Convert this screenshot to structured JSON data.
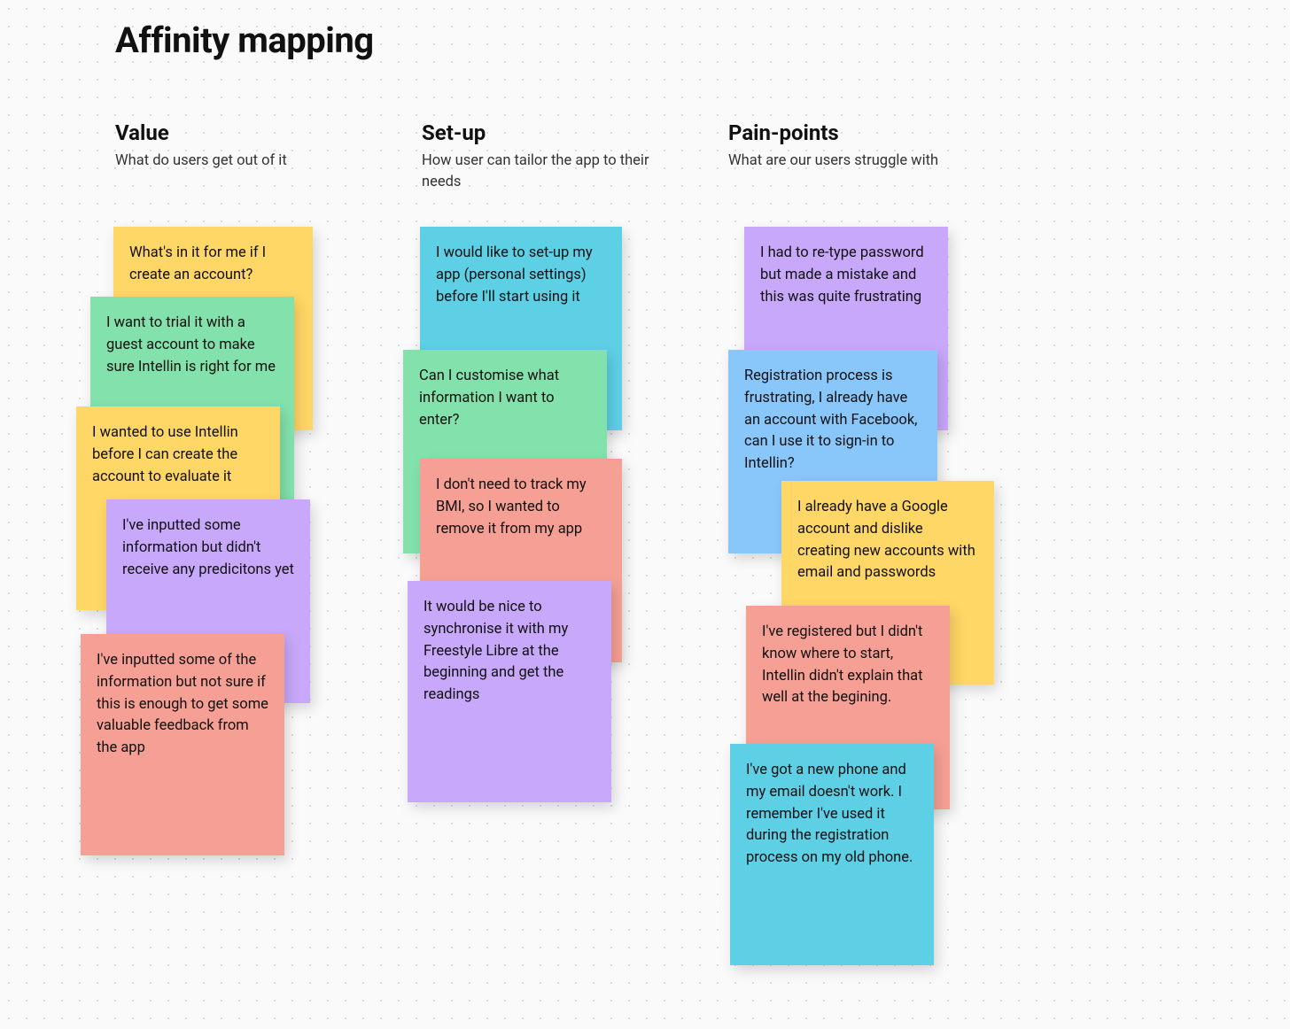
{
  "title": "Affinity mapping",
  "columns": {
    "value": {
      "heading": "Value",
      "sub": "What do users get out of it"
    },
    "setup": {
      "heading": "Set-up",
      "sub": "How user can tailor the app to their needs"
    },
    "pain": {
      "heading": "Pain-points",
      "sub": "What are our users struggle with"
    }
  },
  "notes": {
    "v1": "What's in it for me if I create an account?",
    "v2": "I want to trial it with a guest account to make sure Intellin is right for me",
    "v3": "I wanted to use Intellin before I can create the account to evaluate it",
    "v4": "I've inputted some information but didn't receive any predicitons yet",
    "v5": "I've inputted some of the information but not sure if this is enough to get some valuable feedback from the app",
    "s1": "I would like to set-up my app (personal settings) before I'll start using it",
    "s2": "Can I customise what information I want to enter?",
    "s3": "I don't need to track my BMI, so I wanted to remove it from my app",
    "s4": "It would be nice to synchronise it with my Freestyle Libre at the beginning and get the readings",
    "p1": "I had to re-type password but made a mistake and this was quite frustrating",
    "p2": "Registration process is frustrating, I already have an account with Facebook, can I use it to sign-in to Intellin?",
    "p3": "I already have a Google account and dislike creating new accounts with email and passwords",
    "p4": "I've registered but I didn't know where to start, Intellin didn't explain that well at the begining.",
    "p5": "I've got a new phone and my email doesn't work. I remember I've used it during the registration process on my old phone."
  }
}
